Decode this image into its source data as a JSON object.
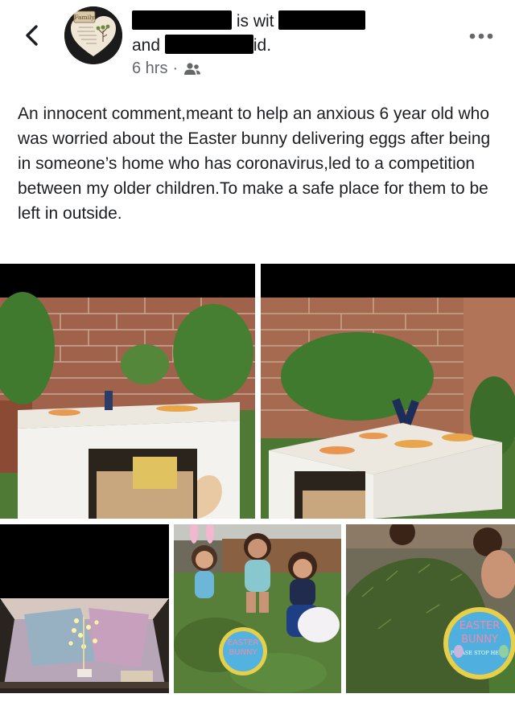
{
  "post": {
    "author_visible_fragment": "is wit",
    "and_label": "and",
    "suffix_fragment": "id.",
    "timestamp": "6 hrs",
    "separator": "·",
    "privacy_icon": "friends-icon",
    "text": "An innocent comment,meant to help an anxious 6 year old who was worried about the Easter bunny delivering eggs after being in someone’s home who has coronavirus,led to a competition between my older children.To make a safe place for them to be left in outside."
  },
  "avatar": {
    "badge_text": "Family",
    "heart_text": "Like branches on a tree we all grow in different directions yet our roots remain as one"
  },
  "photos": {
    "sign_line1": "EASTER",
    "sign_line2": "BUNNY",
    "sign_line3": "PLEASE STOP HERE!"
  },
  "colors": {
    "text": "#1c1e21",
    "meta": "#65676b"
  }
}
